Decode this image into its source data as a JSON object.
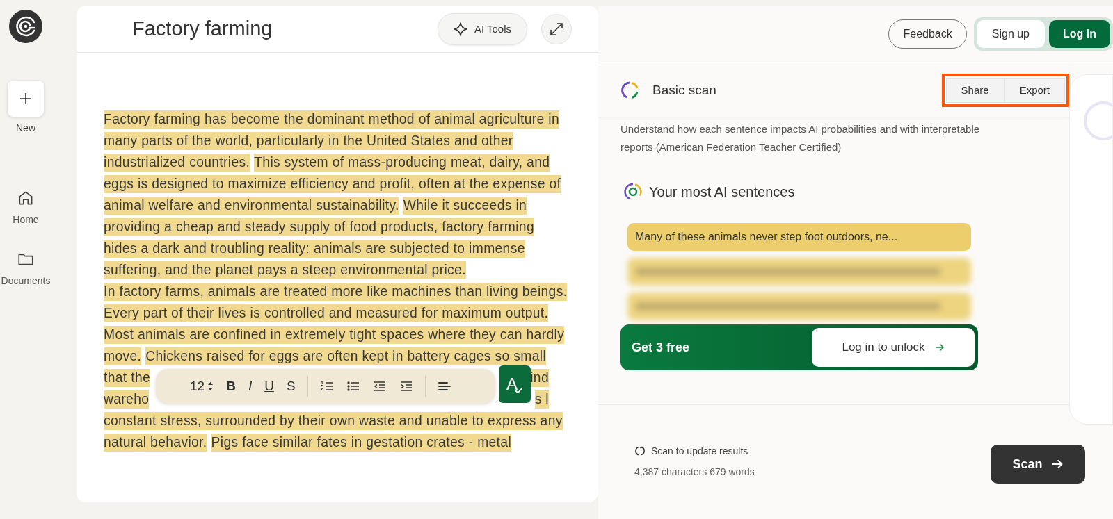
{
  "sidebar": {
    "new_label": "New",
    "items": [
      {
        "kind": "home",
        "label": "Home"
      },
      {
        "kind": "folder",
        "label": "Documents"
      }
    ]
  },
  "editor": {
    "title": "Factory farming",
    "ai_tools": "AI Tools",
    "lines": [
      {
        "segments": [
          "Factory farming has become the dominant method of animal agriculture in"
        ]
      },
      {
        "segments": [
          "many parts of the world, particularly in the United States and other"
        ]
      },
      {
        "segments": [
          "industrialized countries.",
          "This system of mass-producing meat, dairy, and"
        ]
      },
      {
        "segments": [
          "eggs is designed to maximize efficiency and profit, often at the expense of"
        ]
      },
      {
        "segments": [
          "animal welfare and environmental sustainability.",
          "While it succeeds in"
        ]
      },
      {
        "segments": [
          "providing a cheap and steady supply of food products, factory farming"
        ]
      },
      {
        "segments": [
          "hides a dark and troubling reality: animals are subjected to immense"
        ]
      },
      {
        "segments": [
          "suffering, and the planet pays a steep environmental price."
        ]
      },
      {
        "segments": [
          "In factory farms, animals are treated more like machines than living beings."
        ]
      },
      {
        "segments": [
          "Every part of their lives is controlled and measured for maximum output."
        ]
      },
      {
        "segments": [
          "Most animals are confined in extremely tight spaces where they can hardly"
        ]
      },
      {
        "segments": [
          "move.",
          "Chickens raised for eggs are often kept in battery cages so small"
        ]
      },
      {
        "segments": [
          "that the",
          "ind"
        ],
        "covered": true
      },
      {
        "segments": [
          "wareho",
          "s l"
        ],
        "covered": true
      },
      {
        "segments": [
          "constant stress, surrounded by their own waste and unable to express any"
        ]
      },
      {
        "segments": [
          "natural behavior.",
          "Pigs face similar fates in gestation crates - metal"
        ]
      }
    ],
    "toolbar": {
      "font_size": "12",
      "format": [
        {
          "kind": "bold",
          "glyph": "B"
        },
        {
          "kind": "italic",
          "glyph": "I"
        },
        {
          "kind": "underline",
          "glyph": "U"
        },
        {
          "kind": "strike",
          "glyph": "S"
        }
      ],
      "lists": [
        {
          "kind": "numbered"
        },
        {
          "kind": "bulleted"
        },
        {
          "kind": "outdent"
        },
        {
          "kind": "indent"
        }
      ],
      "align": {
        "kind": "align"
      }
    },
    "grammar_button": "A"
  },
  "header": {
    "feedback": "Feedback",
    "sign_up": "Sign up",
    "log_in": "Log in"
  },
  "scan": {
    "title": "Basic scan",
    "share": "Share",
    "export": "Export",
    "description": "Understand how each sentence impacts AI probabilities and with interpretable reports (American Federation Teacher Certified)",
    "sentences_title": "Your most AI sentences",
    "sentences": [
      {
        "text": "Many of these animals never step foot outdoors, ne...",
        "blurred": false
      },
      {
        "blurred": true
      },
      {
        "blurred": true
      }
    ],
    "cta_text": "Get 3 free",
    "cta_button": "Log in to unlock",
    "update_text": "Scan to update results",
    "counts": "4,387 characters 679 words",
    "scan_button": "Scan"
  }
}
